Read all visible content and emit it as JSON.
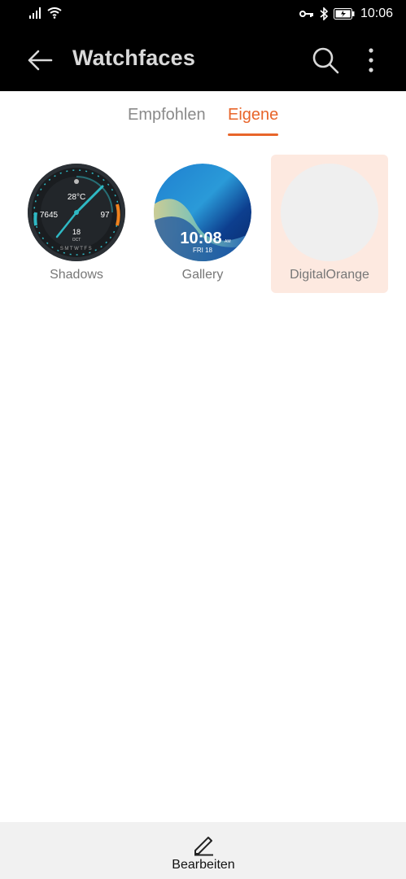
{
  "status_bar": {
    "time": "10:06",
    "icons": [
      "signal-icon",
      "wifi-icon",
      "key-icon",
      "bluetooth-icon",
      "battery-icon"
    ]
  },
  "app_bar": {
    "title": "Watchfaces",
    "icons": [
      "back-arrow-icon",
      "search-icon",
      "more-vert-icon"
    ]
  },
  "tabs": [
    {
      "label": "Empfohlen",
      "active": false
    },
    {
      "label": "Eigene",
      "active": true
    }
  ],
  "watchfaces": [
    {
      "name": "Shadows",
      "steps": "7645",
      "temp": "28°C",
      "heart": "97",
      "date": "18",
      "month": "OCT",
      "days": "SMTWTFS",
      "selected": false
    },
    {
      "name": "Gallery",
      "time": "10:08",
      "ampm": "AM",
      "date": "FRI 18",
      "selected": false
    },
    {
      "name": "DigitalOrange",
      "selected": true
    }
  ],
  "bottom_bar": {
    "edit_label": "Bearbeiten"
  },
  "colors": {
    "accent": "#e8652a",
    "selected_bg": "#fde9e0",
    "bar_bg": "#000000"
  }
}
